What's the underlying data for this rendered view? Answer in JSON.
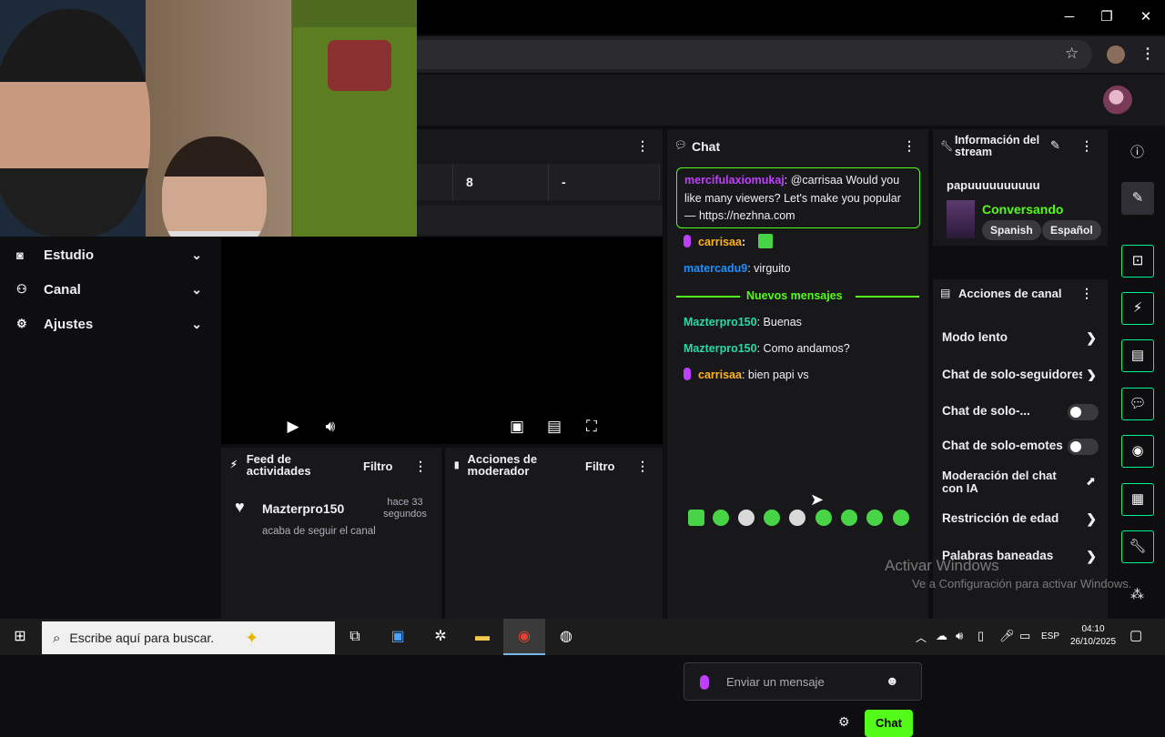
{
  "nav": {
    "items": [
      {
        "label": "Estudio",
        "icon": "studio-icon"
      },
      {
        "label": "Canal",
        "icon": "channel-icon"
      },
      {
        "label": "Ajustes",
        "icon": "gear-icon"
      }
    ]
  },
  "stats": {
    "cells": [
      "8",
      "-"
    ]
  },
  "activity_feed": {
    "title": "Feed de actividades",
    "filter_label": "Filtro",
    "events": [
      {
        "user": "Mazterpro150",
        "time": "hace 33 segundos",
        "text": "acaba de seguir el canal"
      }
    ]
  },
  "mod_actions": {
    "title": "Acciones de moderador",
    "filter_label": "Filtro"
  },
  "chat": {
    "title": "Chat",
    "pinned": {
      "user": "mercifulaxiomukaj",
      "text": ": @carrisaa Would you like many viewers? Let's make you popular — https://nezhna.com"
    },
    "messages": [
      {
        "user": "carrisaa",
        "text": ":",
        "color": "#ffb31a",
        "mic": true
      },
      {
        "user": "matercadu9",
        "text": ": virguito",
        "color": "#1e90ff",
        "mic": false
      }
    ],
    "new_label": "Nuevos mensajes",
    "new_messages": [
      {
        "user": "Mazterpro150",
        "text": ": Buenas",
        "color": "#2bd9a7",
        "mic": false
      },
      {
        "user": "Mazterpro150",
        "text": ": Como andamos?",
        "color": "#2bd9a7",
        "mic": false
      },
      {
        "user": "carrisaa",
        "text": ": bien papi vs",
        "color": "#ffb31a",
        "mic": true
      }
    ],
    "input_placeholder": "Enviar un mensaje",
    "send_label": "Chat"
  },
  "stream_info": {
    "title": "Información del stream",
    "stream_title": "papuuuuuuuuuu",
    "category": "Conversando",
    "tags": [
      "Spanish",
      "Español"
    ]
  },
  "channel_actions": {
    "title": "Acciones de canal",
    "items": [
      {
        "label": "Modo lento",
        "control": "arrow"
      },
      {
        "label": "Chat de solo-seguidores",
        "control": "arrow"
      },
      {
        "label": "Chat de solo-...",
        "control": "toggle"
      },
      {
        "label": "Chat de solo-emotes",
        "control": "toggle"
      },
      {
        "label": "Moderación del chat con IA",
        "control": "external"
      },
      {
        "label": "Restricción de edad",
        "control": "arrow"
      },
      {
        "label": "Palabras baneadas",
        "control": "arrow"
      }
    ]
  },
  "watermark": {
    "line1": "Activar Windows",
    "line2": "Ve a Configuración para activar Windows."
  },
  "taskbar": {
    "search_placeholder": "Escribe aquí para buscar.",
    "lang": "ESP",
    "time": "04:10",
    "date": "26/10/2025"
  },
  "colors": {
    "accent": "#53fc18",
    "twitch_green": "#00f593",
    "bg": "#0e0e10",
    "panel": "#18181b"
  }
}
